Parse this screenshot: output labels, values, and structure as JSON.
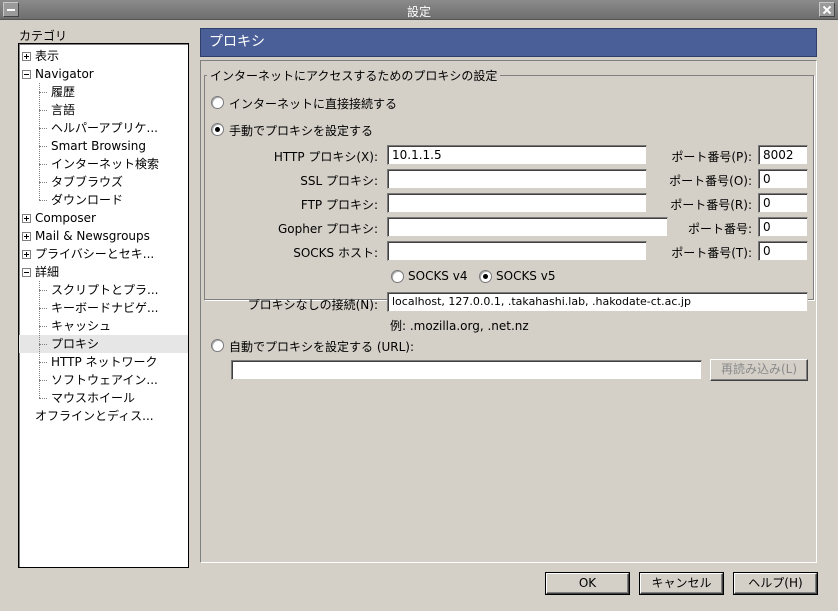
{
  "window": {
    "title": "設定"
  },
  "sidebar": {
    "label": "カテゴリ",
    "items": [
      {
        "label": "表示",
        "level": 0,
        "expander": "plus"
      },
      {
        "label": "Navigator",
        "level": 0,
        "expander": "minus"
      },
      {
        "label": "履歴",
        "level": 1
      },
      {
        "label": "言語",
        "level": 1
      },
      {
        "label": "ヘルパーアプリケ...",
        "level": 1
      },
      {
        "label": "Smart Browsing",
        "level": 1
      },
      {
        "label": "インターネット検索",
        "level": 1
      },
      {
        "label": "タブブラウズ",
        "level": 1
      },
      {
        "label": "ダウンロード",
        "level": 1
      },
      {
        "label": "Composer",
        "level": 0,
        "expander": "plus"
      },
      {
        "label": "Mail & Newsgroups",
        "level": 0,
        "expander": "plus"
      },
      {
        "label": "プライバシーとセキ...",
        "level": 0,
        "expander": "plus"
      },
      {
        "label": "詳細",
        "level": 0,
        "expander": "minus"
      },
      {
        "label": "スクリプトとプラ...",
        "level": 1
      },
      {
        "label": "キーボードナビゲ...",
        "level": 1
      },
      {
        "label": "キャッシュ",
        "level": 1
      },
      {
        "label": "プロキシ",
        "level": 1,
        "selected": true
      },
      {
        "label": "HTTP ネットワーク",
        "level": 1
      },
      {
        "label": "ソフトウェアイン...",
        "level": 1
      },
      {
        "label": "マウスホイール",
        "level": 1
      },
      {
        "label": "オフラインとディス...",
        "level": 0
      }
    ]
  },
  "panel": {
    "title": "プロキシ",
    "group_title": "インターネットにアクセスするためのプロキシの設定",
    "direct_label": "インターネットに直接接続する",
    "manual_label": "手動でプロキシを設定する",
    "proxies": {
      "http": {
        "label": "HTTP プロキシ(X):",
        "value": "10.1.1.5",
        "port_label": "ポート番号(P):",
        "port": "8002"
      },
      "ssl": {
        "label": "SSL プロキシ:",
        "value": "",
        "port_label": "ポート番号(O):",
        "port": "0"
      },
      "ftp": {
        "label": "FTP プロキシ:",
        "value": "",
        "port_label": "ポート番号(R):",
        "port": "0"
      },
      "gopher": {
        "label": "Gopher プロキシ:",
        "value": "",
        "port_label": "ポート番号:",
        "port": "0"
      },
      "socks": {
        "label": "SOCKS ホスト:",
        "value": "",
        "port_label": "ポート番号(T):",
        "port": "0"
      }
    },
    "socks_v4": "SOCKS v4",
    "socks_v5": "SOCKS v5",
    "no_proxy_label": "プロキシなしの接続(N):",
    "no_proxy_value": "localhost, 127.0.0.1, .takahashi.lab, .hakodate-ct.ac.jp",
    "no_proxy_example": "例: .mozilla.org, .net.nz",
    "auto_label": "自動でプロキシを設定する (URL):",
    "auto_url": "",
    "reload_label": "再読み込み(L)"
  },
  "buttons": {
    "ok": "OK",
    "cancel": "キャンセル",
    "help": "ヘルプ(H)"
  },
  "colors": {
    "header_bg": "#4a5f97",
    "dialog_bg": "#d4d0c8"
  }
}
